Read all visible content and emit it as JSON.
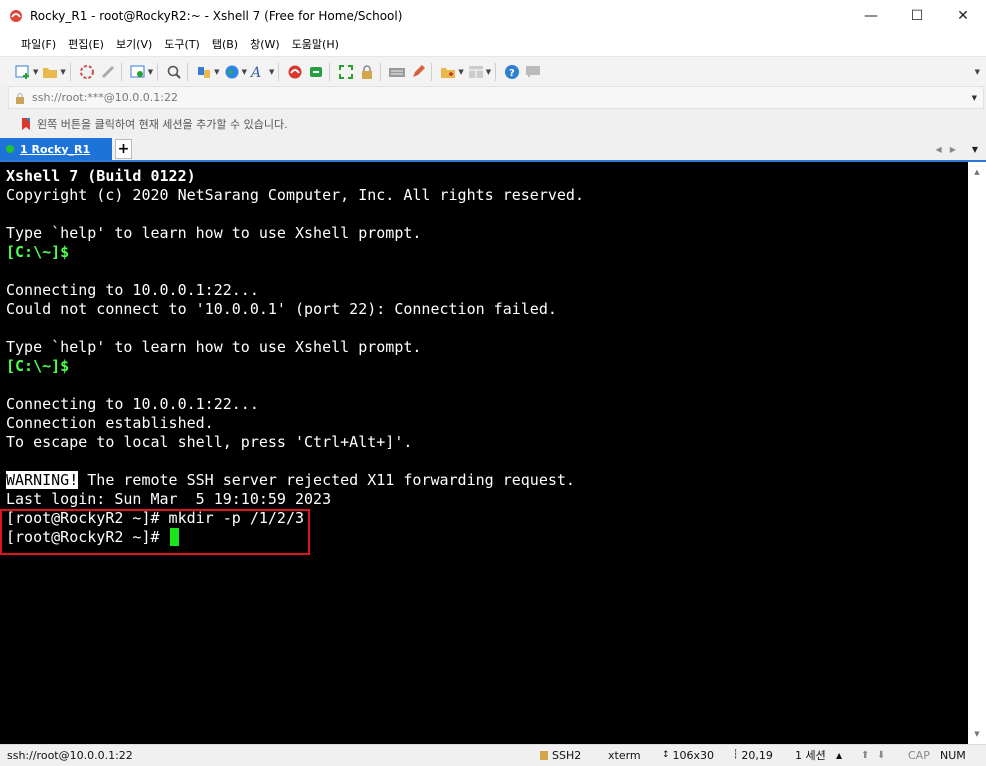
{
  "window": {
    "title": "Rocky_R1 - root@RockyR2:~ - Xshell 7 (Free for Home/School)",
    "minimize_glyph": "—",
    "maximize_glyph": "☐",
    "close_glyph": "✕"
  },
  "menu": {
    "items": [
      "파일(F)",
      "편집(E)",
      "보기(V)",
      "도구(T)",
      "탭(B)",
      "창(W)",
      "도움말(H)"
    ]
  },
  "address": {
    "text": "ssh://root:***@10.0.0.1:22"
  },
  "hint": {
    "text": "왼쪽 버튼을 클릭하여 현재 세션을 추가할 수 있습니다."
  },
  "tabs": {
    "active_label": "1 Rocky_R1",
    "new_tab_glyph": "+"
  },
  "terminal": {
    "lines": [
      "Xshell 7 (Build 0122)",
      "Copyright (c) 2020 NetSarang Computer, Inc. All rights reserved.",
      "",
      "Type `help' to learn how to use Xshell prompt.",
      "[C:\\~]$",
      "",
      "Connecting to 10.0.0.1:22...",
      "Could not connect to '10.0.0.1' (port 22): Connection failed.",
      "",
      "Type `help' to learn how to use Xshell prompt.",
      "[C:\\~]$",
      "",
      "Connecting to 10.0.0.1:22...",
      "Connection established.",
      "To escape to local shell, press 'Ctrl+Alt+]'.",
      "",
      "The remote SSH server rejected X11 forwarding request.",
      "Last login: Sun Mar  5 19:10:59 2023",
      "[root@RockyR2 ~]# mkdir -p /1/2/3",
      "[root@RockyR2 ~]# "
    ],
    "warning_tag": "WARNING!",
    "colors": {
      "background": "#000000",
      "foreground": "#ffffff",
      "prompt_green": "#4cff4c",
      "cursor": "#19e619",
      "highlight_box": "#e0121b"
    }
  },
  "status": {
    "connection": "ssh://root@10.0.0.1:22",
    "protocol": "SSH2",
    "term_type": "xterm",
    "size": "106x30",
    "cursor_pos": "20,19",
    "sessions": "1 세션",
    "caps": "CAP",
    "num": "NUM"
  }
}
